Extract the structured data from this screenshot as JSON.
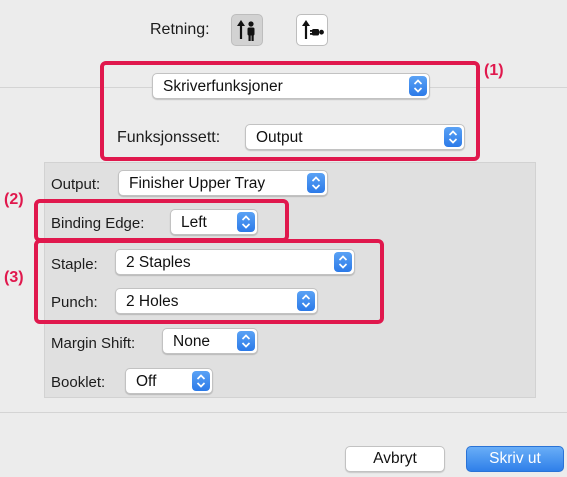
{
  "orientation": {
    "label": "Retning:",
    "options": [
      {
        "name": "portrait",
        "selected": true
      },
      {
        "name": "landscape",
        "selected": false
      }
    ]
  },
  "section_popup": {
    "value": "Skriverfunksjoner"
  },
  "feature_set": {
    "label": "Funksjonssett:",
    "value": "Output"
  },
  "output": {
    "label": "Output:",
    "value": "Finisher Upper Tray"
  },
  "binding_edge": {
    "label": "Binding Edge:",
    "value": "Left"
  },
  "staple": {
    "label": "Staple:",
    "value": "2 Staples"
  },
  "punch": {
    "label": "Punch:",
    "value": "2 Holes"
  },
  "margin_shift": {
    "label": "Margin Shift:",
    "value": "None"
  },
  "booklet": {
    "label": "Booklet:",
    "value": "Off"
  },
  "callouts": {
    "one": "(1)",
    "two": "(2)",
    "three": "(3)",
    "color": "#e0184d"
  },
  "buttons": {
    "cancel": "Avbryt",
    "print": "Skriv ut"
  },
  "colors": {
    "accent": "#2f7fe9",
    "panel": "#e0e0e0",
    "dialog": "#ececec"
  }
}
